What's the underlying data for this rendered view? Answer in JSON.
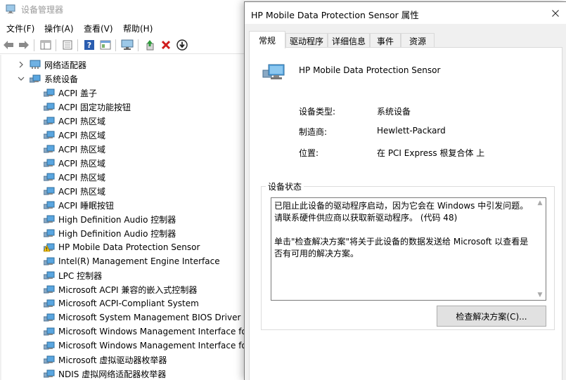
{
  "device_manager": {
    "title": "设备管理器",
    "menu": [
      "文件(F)",
      "操作(A)",
      "查看(V)",
      "帮助(H)"
    ],
    "toolbar_icons": [
      "back-arrow-icon",
      "forward-arrow-icon",
      "show-hide-tree-icon",
      "properties-icon",
      "help-icon",
      "view-icon",
      "monitor-icon",
      "update-driver-icon",
      "uninstall-x-icon",
      "download-arrow-icon"
    ],
    "tree": {
      "network_adapters": "网络适配器",
      "system_devices": "系统设备",
      "children": [
        "ACPI 盖子",
        "ACPI 固定功能按钮",
        "ACPI 热区域",
        "ACPI 热区域",
        "ACPI 热区域",
        "ACPI 热区域",
        "ACPI 热区域",
        "ACPI 热区域",
        "ACPI 睡眠按钮",
        "High Definition Audio 控制器",
        "High Definition Audio 控制器",
        "HP Mobile Data Protection Sensor",
        "Intel(R) Management Engine Interface",
        "LPC 控制器",
        "Microsoft ACPI 兼容的嵌入式控制器",
        "Microsoft ACPI-Compliant System",
        "Microsoft System Management BIOS Driver",
        "Microsoft Windows Management Interface fo",
        "Microsoft Windows Management Interface fo",
        "Microsoft 虚拟驱动器枚举器",
        "NDIS 虚拟网络适配器枚举器"
      ],
      "warning_index": 11
    }
  },
  "dialog": {
    "title": "HP Mobile Data Protection Sensor 属性",
    "tabs": [
      "常规",
      "驱动程序",
      "详细信息",
      "事件",
      "资源"
    ],
    "active_tab": 0,
    "device_name": "HP Mobile Data Protection Sensor",
    "properties": {
      "type_label": "设备类型:",
      "type_value": "系统设备",
      "mfr_label": "制造商:",
      "mfr_value": "Hewlett-Packard",
      "location_label": "位置:",
      "location_value": "在 PCI Express 根复合体 上"
    },
    "status_group_label": "设备状态",
    "status_line1": "已阻止此设备的驱动程序启动，因为它会在 Windows 中引发问题。",
    "status_line2": "请联系硬件供应商以获取新驱动程序。 (代码 48)",
    "status_line3": "单击\"检查解决方案\"将关于此设备的数据发送给 Microsoft 以查看是否有可用的解决方案。",
    "troubleshoot_button": "检查解决方案(C)...",
    "colors": {
      "dialog_bg": "#f0f0f0",
      "panel_bg": "#ffffff",
      "warning": "#f4c20d"
    }
  }
}
